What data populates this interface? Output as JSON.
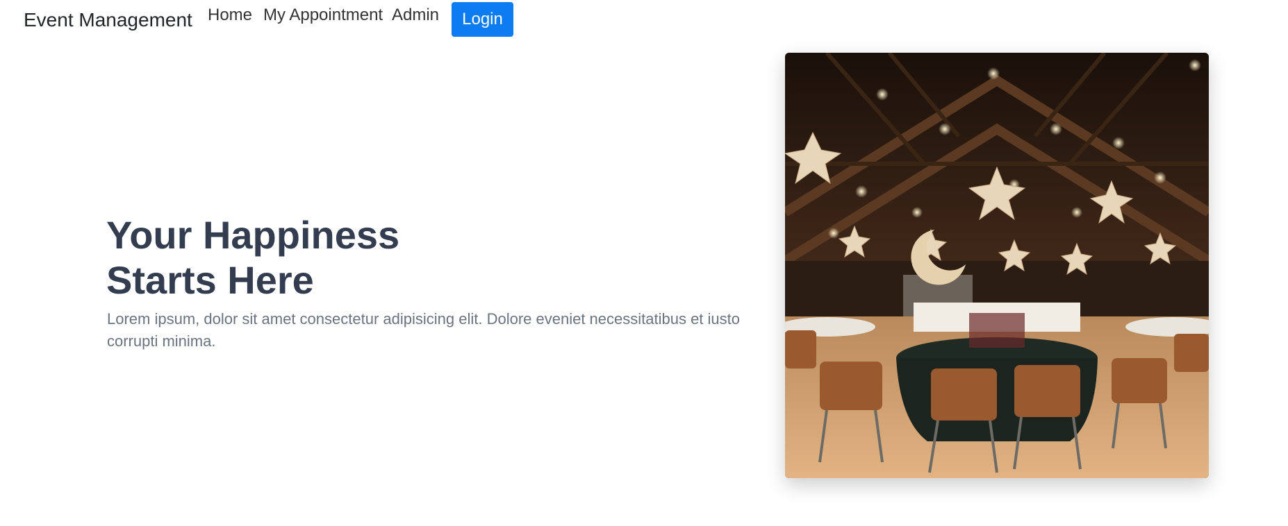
{
  "nav": {
    "brand": "Event Management",
    "links": [
      {
        "label": "Home"
      },
      {
        "label": "My Appointment"
      },
      {
        "label": "Admin"
      }
    ],
    "login_label": "Login",
    "login_color": "#0d7cf2"
  },
  "hero": {
    "title_line1": "Your Happiness",
    "title_line2": "Starts Here",
    "description": "Lorem ipsum, dolor sit amet consectetur adipisicing elit. Dolore eveniet necessitatibus et iusto corrupti minima.",
    "title_color": "#333d4f",
    "text_color": "#6b7380"
  }
}
